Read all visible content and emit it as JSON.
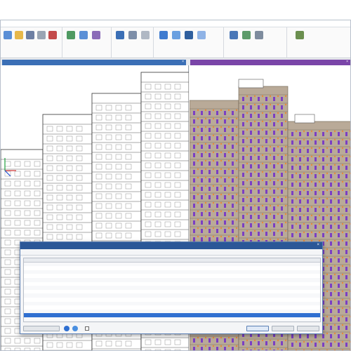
{
  "colors": {
    "accent": "#2b5797",
    "tab_left": "#3b6fb6",
    "tab_right": "#7a45a8",
    "selection": "#2f6fd1",
    "structure": "#8a7a68",
    "anchors": "#e8893a",
    "openings": "#7b3fc4"
  },
  "ribbon": {
    "groups": [
      {
        "caption": "",
        "buttons": [
          "document-icon",
          "open-icon",
          "save-icon",
          "print-icon"
        ]
      },
      {
        "caption": "",
        "buttons": [
          "select-icon",
          "filter-icon",
          "layers-icon"
        ]
      },
      {
        "caption": "",
        "buttons": [
          "view-icon",
          "section-icon",
          "settings-icon"
        ]
      },
      {
        "caption": "",
        "buttons": [
          "cube-icon",
          "grid-icon",
          "table-icon"
        ]
      },
      {
        "caption": "",
        "buttons": [
          "render-icon",
          "export-icon"
        ]
      },
      {
        "caption": "",
        "buttons": [
          "report-icon"
        ]
      }
    ]
  },
  "viewports": {
    "left_tab": "",
    "right_tab": ""
  },
  "dialog": {
    "title": "",
    "toolbar": [
      "",
      "",
      ""
    ],
    "columns": [
      "",
      "",
      "",
      "",
      "",
      "",
      "",
      "",
      "",
      ""
    ],
    "rows": [
      {
        "id": "",
        "sel": false
      },
      {
        "id": "",
        "sel": false
      },
      {
        "id": "",
        "sel": false
      },
      {
        "id": "",
        "sel": false
      },
      {
        "id": "",
        "sel": false
      },
      {
        "id": "",
        "sel": false
      },
      {
        "id": "",
        "sel": false
      },
      {
        "id": "",
        "sel": false
      },
      {
        "id": "",
        "sel": false
      },
      {
        "id": "",
        "sel": false
      },
      {
        "id": "",
        "sel": false
      },
      {
        "id": "",
        "sel": false
      },
      {
        "id": "",
        "sel": false
      },
      {
        "id": "",
        "sel": true
      },
      {
        "id": "",
        "sel": false
      }
    ],
    "checkbox_label": "",
    "buttons": [
      "",
      "",
      ""
    ]
  }
}
